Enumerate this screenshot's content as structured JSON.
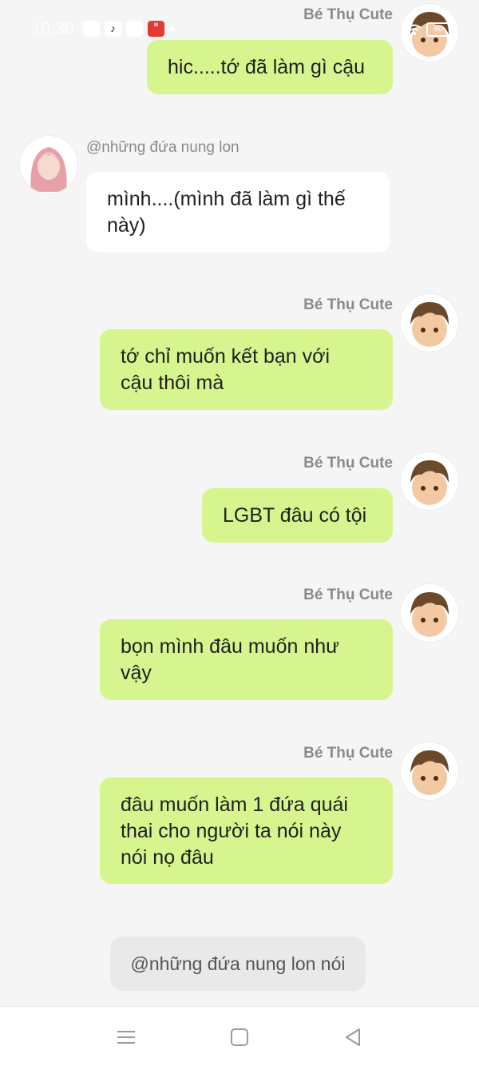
{
  "status_bar": {
    "time": "10:30",
    "battery": "80",
    "icons": [
      "video-icon",
      "tiktok-icon",
      "message-icon",
      "mangatoon-icon",
      "dot-icon",
      "wifi-icon",
      "battery-icon"
    ]
  },
  "messages": [
    {
      "side": "right",
      "sender": "Bé Thụ Cute",
      "lines": [
        "hic.....tớ đã làm gì cậu"
      ]
    },
    {
      "side": "left",
      "sender": "@những đứa nung lon",
      "lines": [
        "mình....(mình đã làm gì thế",
        "này)"
      ]
    },
    {
      "side": "right",
      "sender": "Bé Thụ Cute",
      "lines": [
        "tớ chỉ muốn kết bạn với",
        "cậu thôi mà"
      ]
    },
    {
      "side": "right",
      "sender": "Bé Thụ Cute",
      "lines": [
        "LGBT đâu có tội"
      ]
    },
    {
      "side": "right",
      "sender": "Bé Thụ Cute",
      "lines": [
        "bọn mình đâu muốn như",
        "vậy"
      ]
    },
    {
      "side": "right",
      "sender": "Bé Thụ Cute",
      "lines": [
        "đâu muốn làm 1 đứa quái",
        "thai cho người ta nói này",
        "nói nọ đâu"
      ]
    }
  ],
  "narrate_button": "@những đứa nung lon nói",
  "nav": {
    "menu_icon": "menu-icon",
    "home_icon": "home-square-icon",
    "back_icon": "back-triangle-icon"
  },
  "colors": {
    "right_bubble": "#d6f58e",
    "left_bubble": "#ffffff",
    "background": "#f5f5f5"
  }
}
